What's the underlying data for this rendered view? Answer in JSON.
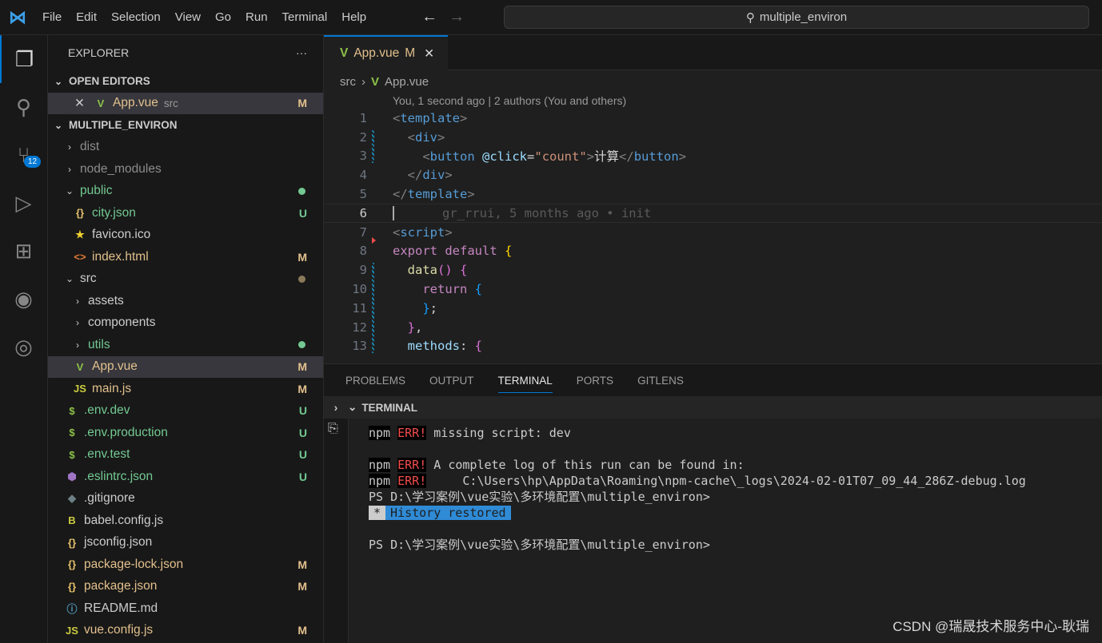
{
  "titlebar": {
    "menu": [
      "File",
      "Edit",
      "Selection",
      "View",
      "Go",
      "Run",
      "Terminal",
      "Help"
    ],
    "search": "multiple_environ"
  },
  "activity": {
    "scm_badge": "12"
  },
  "explorer": {
    "title": "EXPLORER",
    "open_editors": "OPEN EDITORS",
    "open_file": {
      "name": "App.vue",
      "dir": "src",
      "status": "M"
    },
    "project": "MULTIPLE_ENVIRON",
    "items": [
      {
        "name": "dist",
        "type": "folder",
        "depth": 1,
        "color": "#8c8c8c"
      },
      {
        "name": "node_modules",
        "type": "folder",
        "depth": 1,
        "color": "#8c8c8c"
      },
      {
        "name": "public",
        "type": "folder",
        "depth": 1,
        "color": "#73c991",
        "dot": "#73c991",
        "open": true
      },
      {
        "name": "city.json",
        "icon": "{}",
        "iconColor": "#e8c56b",
        "depth": 2,
        "color": "#73c991",
        "status": "U"
      },
      {
        "name": "favicon.ico",
        "icon": "★",
        "iconColor": "#f0d030",
        "depth": 2,
        "color": "#ccc"
      },
      {
        "name": "index.html",
        "icon": "<>",
        "iconColor": "#e37933",
        "depth": 2,
        "color": "#e2c08d",
        "status": "M"
      },
      {
        "name": "src",
        "type": "folder",
        "depth": 1,
        "color": "#ccc",
        "dot": "#8a7a5a",
        "open": true
      },
      {
        "name": "assets",
        "type": "folder",
        "depth": 2,
        "color": "#ccc"
      },
      {
        "name": "components",
        "type": "folder",
        "depth": 2,
        "color": "#ccc"
      },
      {
        "name": "utils",
        "type": "folder",
        "depth": 2,
        "color": "#73c991",
        "dot": "#73c991"
      },
      {
        "name": "App.vue",
        "icon": "V",
        "iconColor": "#8dc149",
        "depth": 2,
        "color": "#e2c08d",
        "status": "M",
        "selected": true
      },
      {
        "name": "main.js",
        "icon": "JS",
        "iconColor": "#cbcb41",
        "depth": 2,
        "color": "#e2c08d",
        "status": "M"
      },
      {
        "name": ".env.dev",
        "icon": "$",
        "iconColor": "#8dc149",
        "depth": 1,
        "color": "#73c991",
        "status": "U"
      },
      {
        "name": ".env.production",
        "icon": "$",
        "iconColor": "#8dc149",
        "depth": 1,
        "color": "#73c991",
        "status": "U"
      },
      {
        "name": ".env.test",
        "icon": "$",
        "iconColor": "#8dc149",
        "depth": 1,
        "color": "#73c991",
        "status": "U"
      },
      {
        "name": ".eslintrc.json",
        "icon": "⬢",
        "iconColor": "#a074c4",
        "depth": 1,
        "color": "#73c991",
        "status": "U"
      },
      {
        "name": ".gitignore",
        "icon": "◆",
        "iconColor": "#6d8086",
        "depth": 1,
        "color": "#ccc"
      },
      {
        "name": "babel.config.js",
        "icon": "B",
        "iconColor": "#cbcb41",
        "depth": 1,
        "color": "#ccc"
      },
      {
        "name": "jsconfig.json",
        "icon": "{}",
        "iconColor": "#e8c56b",
        "depth": 1,
        "color": "#ccc"
      },
      {
        "name": "package-lock.json",
        "icon": "{}",
        "iconColor": "#e8c56b",
        "depth": 1,
        "color": "#e2c08d",
        "status": "M"
      },
      {
        "name": "package.json",
        "icon": "{}",
        "iconColor": "#e8c56b",
        "depth": 1,
        "color": "#e2c08d",
        "status": "M"
      },
      {
        "name": "README.md",
        "icon": "ⓘ",
        "iconColor": "#519aba",
        "depth": 1,
        "color": "#ccc"
      },
      {
        "name": "vue.config.js",
        "icon": "JS",
        "iconColor": "#cbcb41",
        "depth": 1,
        "color": "#e2c08d",
        "status": "M"
      }
    ]
  },
  "editor": {
    "tab": {
      "name": "App.vue",
      "status": "M"
    },
    "breadcrumb": [
      "src",
      "App.vue"
    ],
    "blame_header": "You, 1 second ago | 2 authors (You and others)",
    "inline_blame": "gr_rrui, 5 months ago • init",
    "lines": [
      [
        [
          "tg",
          "<"
        ],
        [
          "tn",
          "template"
        ],
        [
          "tg",
          ">"
        ]
      ],
      [
        [
          "tx",
          "  "
        ],
        [
          "tg",
          "<"
        ],
        [
          "tn",
          "div"
        ],
        [
          "tg",
          ">"
        ]
      ],
      [
        [
          "tx",
          "    "
        ],
        [
          "tg",
          "<"
        ],
        [
          "tn",
          "button"
        ],
        [
          "tx",
          " "
        ],
        [
          "at",
          "@click"
        ],
        [
          "tx",
          "="
        ],
        [
          "s",
          "\"count\""
        ],
        [
          "tg",
          ">"
        ],
        [
          "tx",
          "计算"
        ],
        [
          "tg",
          "</"
        ],
        [
          "tn",
          "button"
        ],
        [
          "tg",
          ">"
        ]
      ],
      [
        [
          "tx",
          "  "
        ],
        [
          "tg",
          "</"
        ],
        [
          "tn",
          "div"
        ],
        [
          "tg",
          ">"
        ]
      ],
      [
        [
          "tg",
          "</"
        ],
        [
          "tn",
          "template"
        ],
        [
          "tg",
          ">"
        ]
      ],
      [],
      [
        [
          "tg",
          "<"
        ],
        [
          "tn",
          "script"
        ],
        [
          "tg",
          ">"
        ]
      ],
      [
        [
          "kw",
          "export"
        ],
        [
          "tx",
          " "
        ],
        [
          "kw",
          "default"
        ],
        [
          "tx",
          " "
        ],
        [
          "b1",
          "{"
        ]
      ],
      [
        [
          "tx",
          "  "
        ],
        [
          "fn",
          "data"
        ],
        [
          "b2",
          "()"
        ],
        [
          "tx",
          " "
        ],
        [
          "b2",
          "{"
        ]
      ],
      [
        [
          "tx",
          "    "
        ],
        [
          "kw",
          "return"
        ],
        [
          "tx",
          " "
        ],
        [
          "b3",
          "{"
        ]
      ],
      [
        [
          "tx",
          "    "
        ],
        [
          "b3",
          "}"
        ],
        [
          "tx",
          ";"
        ]
      ],
      [
        [
          "tx",
          "  "
        ],
        [
          "b2",
          "}"
        ],
        [
          "tx",
          ","
        ]
      ],
      [
        [
          "tx",
          "  "
        ],
        [
          "at",
          "methods"
        ],
        [
          "tx",
          ": "
        ],
        [
          "b2",
          "{"
        ]
      ]
    ]
  },
  "panel": {
    "tabs": [
      "PROBLEMS",
      "OUTPUT",
      "TERMINAL",
      "PORTS",
      "GITLENS"
    ],
    "active": "TERMINAL",
    "section": "TERMINAL",
    "terminal": {
      "l1": " missing script: dev",
      "l2": " A complete log of this run can be found in:",
      "l3": "     C:\\Users\\hp\\AppData\\Roaming\\npm-cache\\_logs\\2024-02-01T07_09_44_286Z-debug.log",
      "prompt": "PS D:\\学习案例\\vue实验\\多环境配置\\multiple_environ>",
      "npm": "npm",
      "err": "ERR!",
      "hist_star": "*",
      "hist": "History restored"
    }
  },
  "watermark": "CSDN @瑞晟技术服务中心-耿瑞"
}
